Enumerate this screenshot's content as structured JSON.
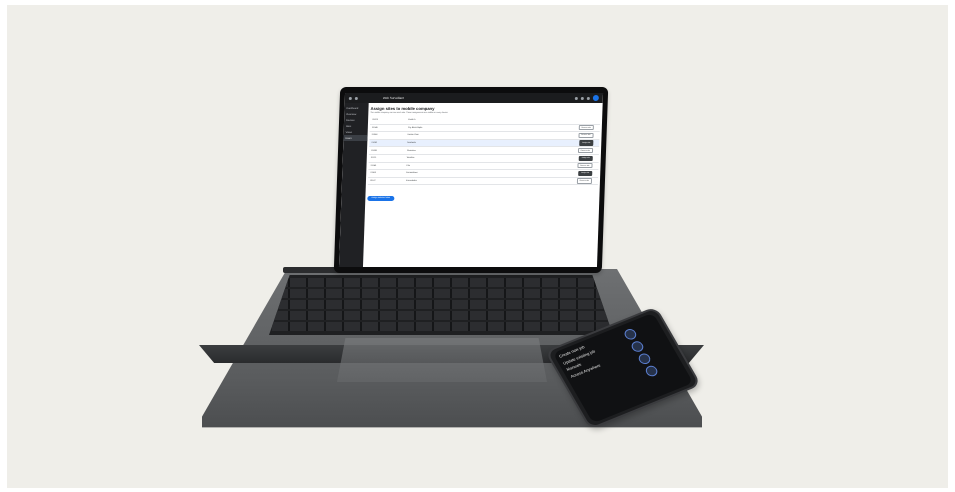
{
  "laptop": {
    "topbar": {
      "title": "Web Surveillant"
    },
    "sidebar": {
      "items": [
        {
          "label": "Dashboard"
        },
        {
          "label": "Overview"
        },
        {
          "label": "Devices"
        },
        {
          "label": "Sites"
        },
        {
          "label": "Views"
        },
        {
          "label": "Users"
        }
      ]
    },
    "page": {
      "title": "Assign sites to mobile company",
      "subtitle": "The mobile company can see each site. These assignments are visible on every device.",
      "rows": [
        {
          "id": "S1023",
          "name": "Zenith A",
          "action": ""
        },
        {
          "id": "S1045",
          "name": "City Block Alpha",
          "action": "Remove site"
        },
        {
          "id": "S1068",
          "name": "Harbor Gate",
          "action": "Remove site"
        },
        {
          "id": "S1082",
          "name": "Northside",
          "action": "Assign site"
        },
        {
          "id": "S1099",
          "name": "Riverview",
          "action": "Remove site"
        },
        {
          "id": "S1121",
          "name": "Westline",
          "action": "Assign site"
        },
        {
          "id": "S1140",
          "name": "Elm",
          "action": "Remove site"
        },
        {
          "id": "S1163",
          "name": "Ferrandtown",
          "action": "Assign site"
        },
        {
          "id": "S1187",
          "name": "Kronenbahn",
          "action": "Remove site"
        }
      ],
      "primary_button": "Assign selected sites"
    }
  },
  "phone": {
    "items": [
      {
        "label": "Create new job"
      },
      {
        "label": "Update existing job"
      },
      {
        "label": "Manuals"
      },
      {
        "label": "Access Anywhere"
      }
    ]
  }
}
